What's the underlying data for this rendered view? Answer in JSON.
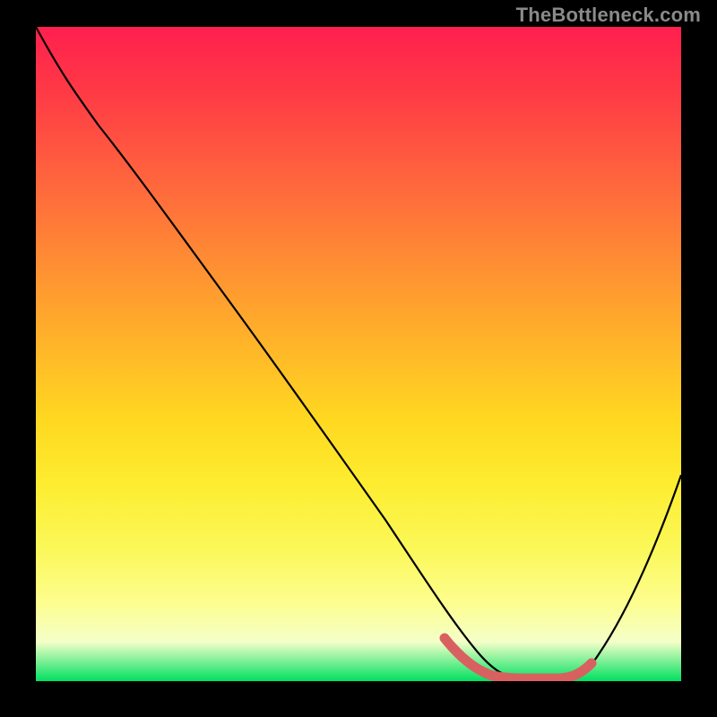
{
  "watermark": "TheBottleneck.com",
  "chart_data": {
    "type": "line",
    "title": "",
    "xlabel": "",
    "ylabel": "",
    "xlim": [
      0,
      100
    ],
    "ylim": [
      0,
      100
    ],
    "series": [
      {
        "name": "curve",
        "x": [
          0,
          7,
          15,
          25,
          35,
          45,
          55,
          63,
          68,
          72,
          78,
          82,
          86,
          92,
          100
        ],
        "values": [
          100,
          92,
          85,
          72,
          59,
          46,
          33,
          20,
          10,
          3,
          1,
          1,
          3,
          15,
          40
        ]
      }
    ],
    "marker_segment": {
      "x0": 63,
      "x1": 82
    },
    "gradient_stops": [
      {
        "pct": 0,
        "color": "#ff1f4f"
      },
      {
        "pct": 50,
        "color": "#ffb928"
      },
      {
        "pct": 88,
        "color": "#fdfe8f"
      },
      {
        "pct": 100,
        "color": "#00e060"
      }
    ]
  }
}
